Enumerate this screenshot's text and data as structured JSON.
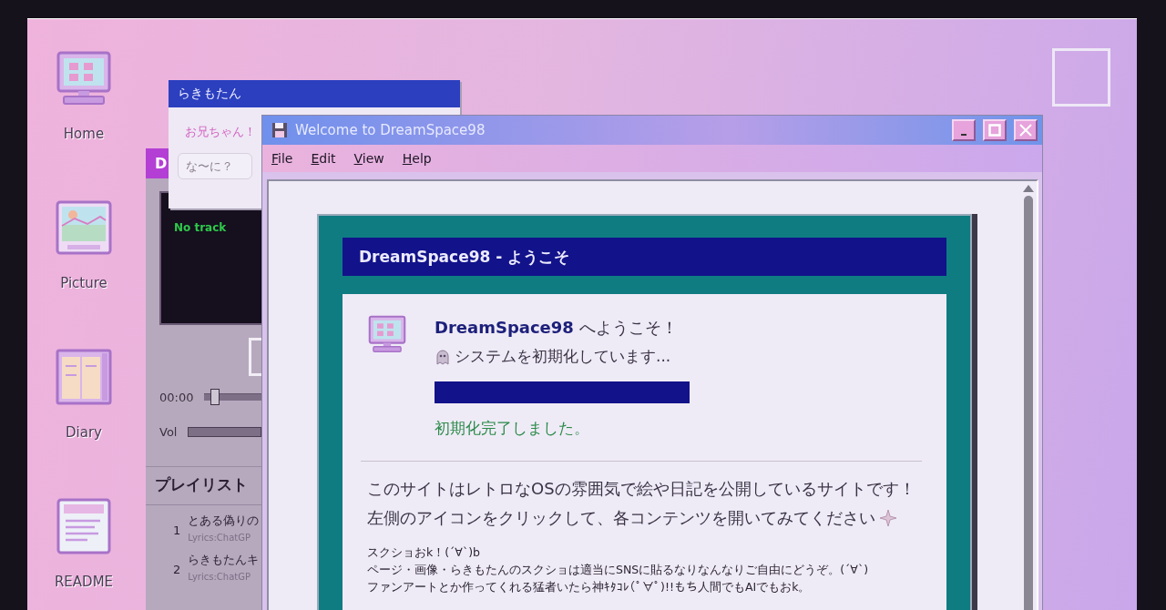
{
  "desktop_icons": [
    {
      "label": "Home",
      "kind": "monitor"
    },
    {
      "label": "Picture",
      "kind": "picture"
    },
    {
      "label": "Diary",
      "kind": "diary"
    },
    {
      "label": "README",
      "kind": "readme"
    }
  ],
  "player": {
    "title": "D",
    "status": "No track",
    "time": "00:00",
    "seek": {
      "level": 0.1
    },
    "volume_label": "Vol",
    "volume": {
      "level": 1
    },
    "playlist_title": "プレイリスト",
    "tracks": [
      {
        "number": "1",
        "title": "とある偽りの",
        "credit": "Lyrics:ChatGP"
      },
      {
        "number": "2",
        "title": "らきもたんキ",
        "credit": "Lyrics:ChatGP"
      }
    ]
  },
  "chat": {
    "title": "らきもたん",
    "message": "お兄ちゃん！",
    "reply": {
      "placeholder": "な〜に？"
    }
  },
  "window": {
    "title": "Welcome to DreamSpace98",
    "menu": [
      "File",
      "Edit",
      "View",
      "Help"
    ]
  },
  "panel": {
    "header": "DreamSpace98 - ようこそ",
    "welcome": "**DreamSpace98** へようこそ！",
    "status": "システムを初期化しています...",
    "progress": {
      "level": 1
    },
    "done": "初期化完了しました。",
    "intro": [
      "このサイトはレトロなOSの雰囲気で絵や日記を公開しているサイトです！",
      "左側のアイコンをクリックして、各コンテンツを開いてみてください"
    ],
    "notes": [
      "スクショおk！(´∀`)b",
      "ページ・画像・らきもたんのスクショは適当にSNSに貼るなりなんなりご自由にどうぞ。(´∀`)",
      "ファンアートとか作ってくれる猛者いたら神ｷﾀｺﾚ(ﾟ∀ﾟ)!!もち人間でもAIでもおk。"
    ]
  }
}
